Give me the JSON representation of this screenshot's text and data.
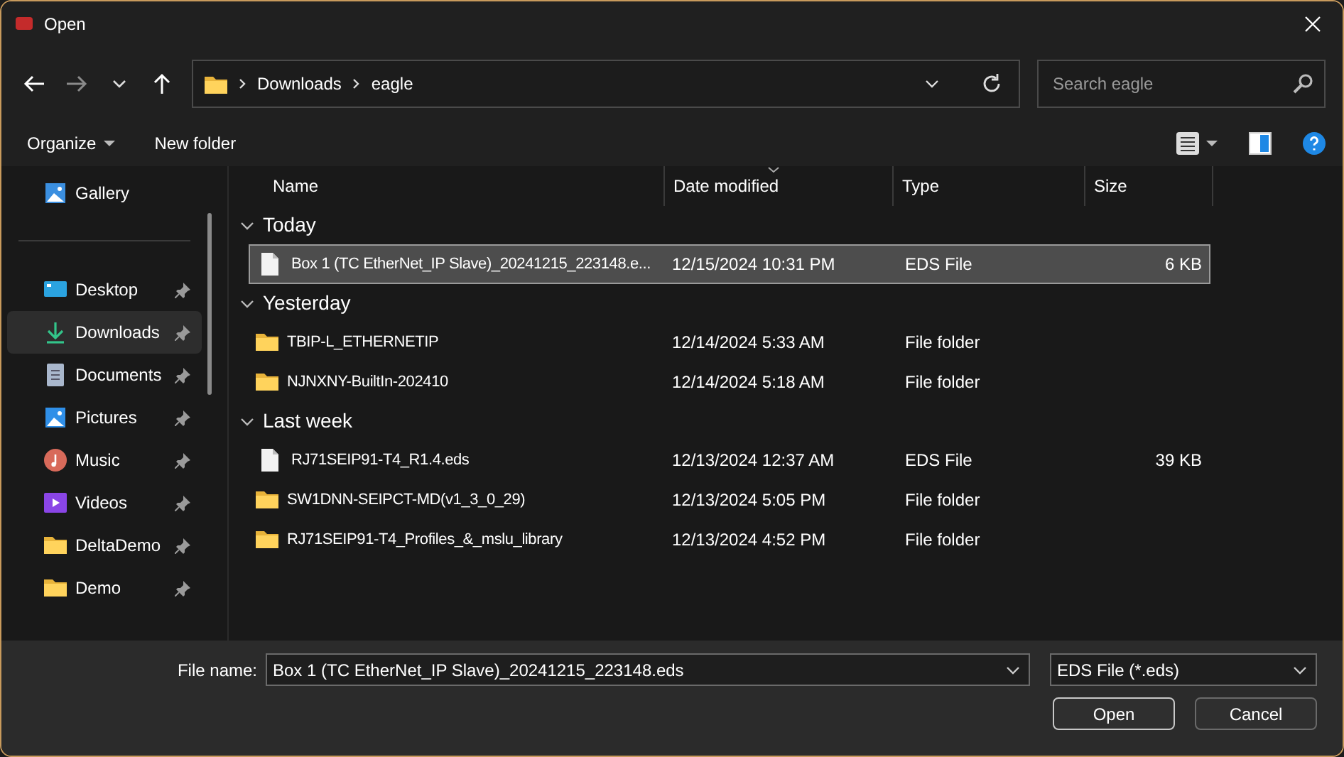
{
  "window": {
    "title": "Open"
  },
  "address": {
    "crumbs": [
      "Downloads",
      "eagle"
    ]
  },
  "search": {
    "placeholder": "Search eagle"
  },
  "toolbar": {
    "organize": "Organize",
    "new_folder": "New folder"
  },
  "sidebar": {
    "items": [
      {
        "label": "Gallery",
        "kind": "gallery",
        "pinned": false,
        "selected": false
      },
      {
        "label": "Desktop",
        "kind": "desktop",
        "pinned": true,
        "selected": false
      },
      {
        "label": "Downloads",
        "kind": "downloads",
        "pinned": true,
        "selected": true
      },
      {
        "label": "Documents",
        "kind": "documents",
        "pinned": true,
        "selected": false
      },
      {
        "label": "Pictures",
        "kind": "pictures",
        "pinned": true,
        "selected": false
      },
      {
        "label": "Music",
        "kind": "music",
        "pinned": true,
        "selected": false
      },
      {
        "label": "Videos",
        "kind": "videos",
        "pinned": true,
        "selected": false
      },
      {
        "label": "DeltaDemo",
        "kind": "folder",
        "pinned": true,
        "selected": false
      },
      {
        "label": "Demo",
        "kind": "folder",
        "pinned": true,
        "selected": false
      }
    ]
  },
  "columns": [
    {
      "label": "Name",
      "sorted": false
    },
    {
      "label": "Date modified",
      "sorted": true
    },
    {
      "label": "Type",
      "sorted": false
    },
    {
      "label": "Size",
      "sorted": false
    }
  ],
  "groups": [
    {
      "label": "Today",
      "expanded": true,
      "files": [
        {
          "name": "Box 1 (TC EtherNet_IP Slave)_20241215_223148.e...",
          "kind": "file",
          "date": "12/15/2024 10:31 PM",
          "type": "EDS File",
          "size": "6 KB",
          "selected": true
        }
      ]
    },
    {
      "label": "Yesterday",
      "expanded": true,
      "files": [
        {
          "name": "TBIP-L_ETHERNETIP",
          "kind": "folder",
          "date": "12/14/2024 5:33 AM",
          "type": "File folder",
          "selected": false
        },
        {
          "name": "NJNXNY-BuiltIn-202410",
          "kind": "folder",
          "date": "12/14/2024 5:18 AM",
          "type": "File folder",
          "selected": false
        }
      ]
    },
    {
      "label": "Last week",
      "expanded": true,
      "files": [
        {
          "name": "RJ71SEIP91-T4_R1.4.eds",
          "kind": "file",
          "date": "12/13/2024 12:37 AM",
          "type": "EDS File",
          "size": "39 KB",
          "selected": false
        },
        {
          "name": "SW1DNN-SEIPCT-MD(v1_3_0_29)",
          "kind": "folder",
          "date": "12/13/2024 5:05 PM",
          "type": "File folder",
          "selected": false
        },
        {
          "name": "RJ71SEIP91-T4_Profiles_&_mslu_library",
          "kind": "folder",
          "date": "12/13/2024 4:52 PM",
          "type": "File folder",
          "selected": false
        }
      ]
    }
  ],
  "footer": {
    "file_name_label": "File name:",
    "file_name": "Box 1 (TC EtherNet_IP Slave)_20241215_223148.eds",
    "filter": "EDS File (*.eds)",
    "open": "Open",
    "cancel": "Cancel"
  }
}
